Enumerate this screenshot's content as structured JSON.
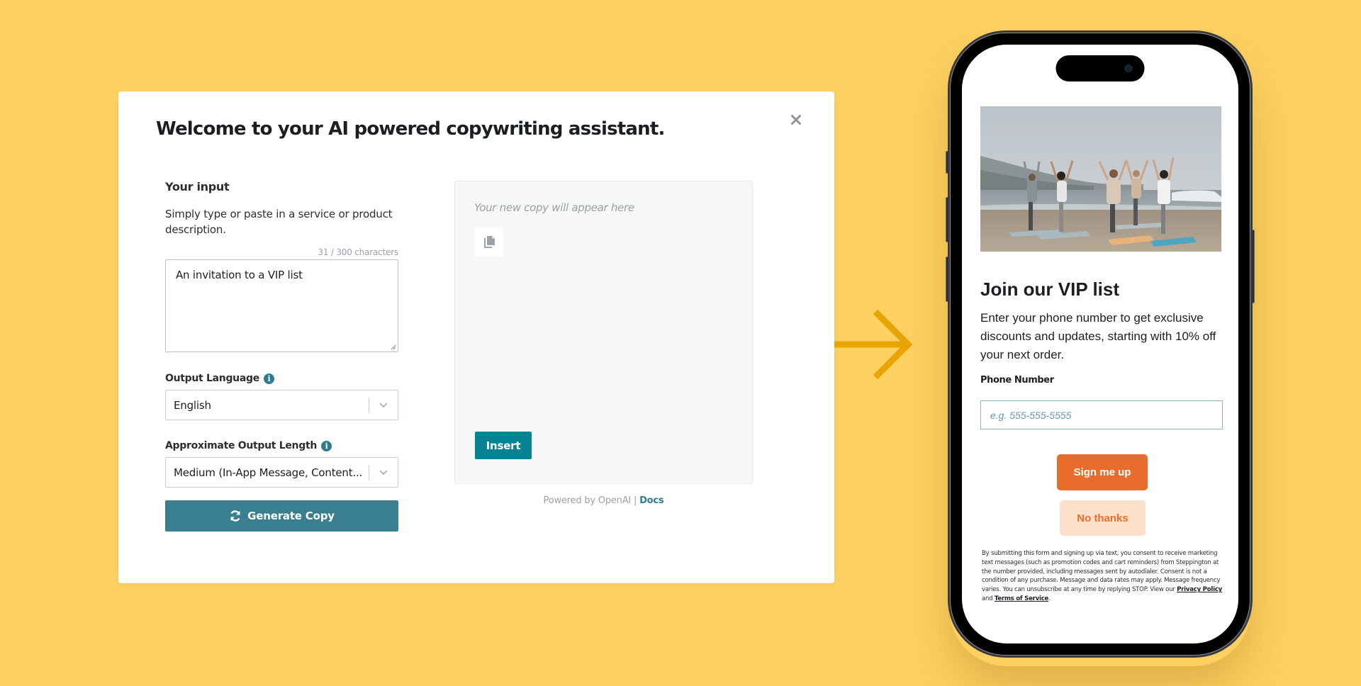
{
  "colors": {
    "background": "#FDD062",
    "teal_accent": "#3a7f90",
    "insert_button": "#048394",
    "arrow": "#E8A400",
    "signup_orange": "#e86d2d",
    "nothanks_bg": "#fde0ca"
  },
  "modal": {
    "title": "Welcome to your AI powered copywriting assistant.",
    "close_icon": "close-icon",
    "input_section": {
      "title": "Your input",
      "description": "Simply type or paste in a service or product description.",
      "char_count": "31 / 300 characters",
      "input_value": "An invitation to a VIP list"
    },
    "output_language": {
      "label": "Output Language",
      "info_icon": "info-icon",
      "selected": "English"
    },
    "output_length": {
      "label": "Approximate Output Length",
      "info_icon": "info-icon",
      "selected": "Medium (In-App Message, Content..."
    },
    "generate_button": {
      "label": "Generate Copy",
      "icon": "refresh-icon"
    },
    "output": {
      "placeholder": "Your new copy will appear here",
      "copy_icon": "copy-icon",
      "insert_label": "Insert"
    },
    "footer": {
      "powered_by": "Powered by OpenAI | ",
      "docs_link": "Docs"
    }
  },
  "arrow_icon": "arrow-right-icon",
  "phone": {
    "image_alt": "Group doing yoga tree pose on a beach",
    "heading": "Join our VIP list",
    "body": "Enter your phone number to get exclusive discounts and updates, starting with 10% off your next order.",
    "phone_label": "Phone Number",
    "phone_placeholder": "e.g. 555-555-5555",
    "signup_label": "Sign me up",
    "nothanks_label": "No thanks",
    "legal_text": "By submitting this form and signing up via text, you consent to receive marketing text messages (such as promotion codes and cart reminders) from Steppington at the number provided, including messages sent by autodialer. Consent is not a condition of any purchase. Message and data rates may apply. Message frequency varies. You can unsubscribe at any time by replying STOP. View our ",
    "privacy_link": "Privacy Policy",
    "legal_and": " and ",
    "terms_link": "Terms of Service",
    "legal_end": "."
  }
}
